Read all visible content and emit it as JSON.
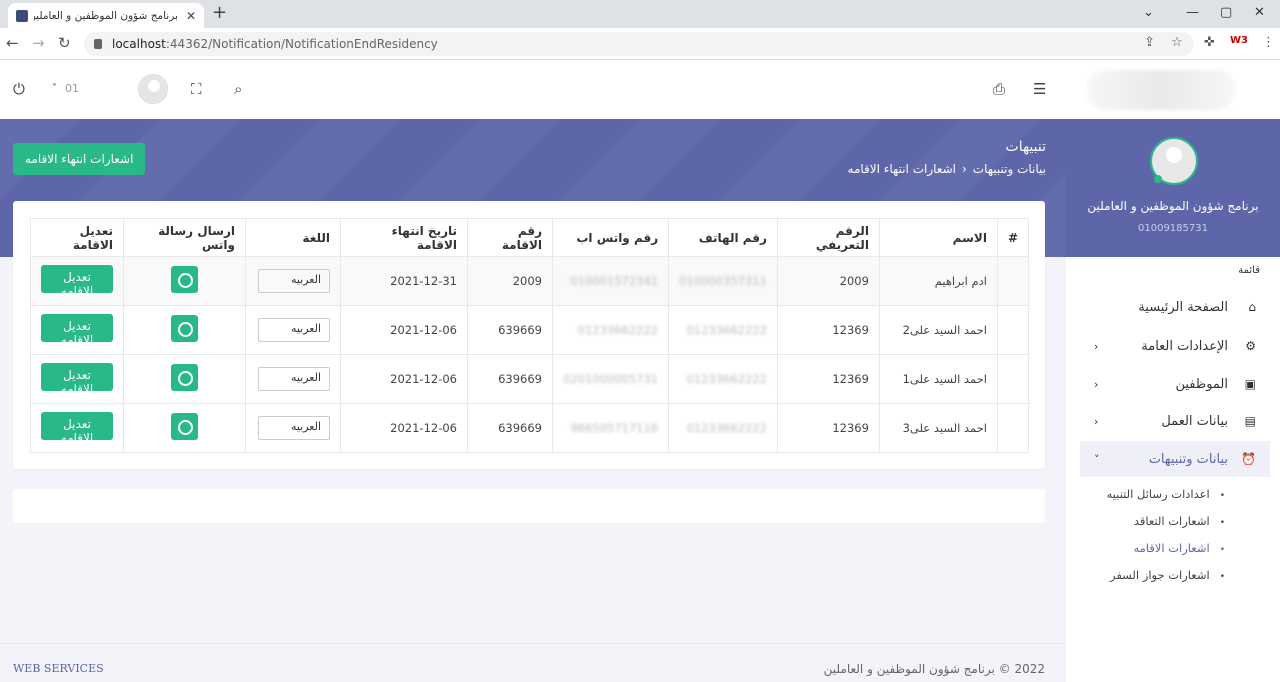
{
  "browser": {
    "tab_title": "برنامج شؤون الموظفين و العاملين",
    "url_host": "localhost",
    "url_path": ":44362/Notification/NotificationEndResidency"
  },
  "topbar": {
    "user_name_hidden": "01",
    "icons": [
      "power-icon",
      "chevron-down-icon",
      "avatar",
      "fullscreen-icon",
      "search-icon",
      "print-icon",
      "menu-icon"
    ]
  },
  "banner": {
    "title": "تنبيهات",
    "breadcrumb_parent": "بيانات وتنبيهات",
    "breadcrumb_current": "اشعارات انتهاء الاقامه",
    "action_button": "اشعارات انتهاء الاقامه"
  },
  "table": {
    "headers": [
      "#",
      "الاسم",
      "الرقم التعريفي",
      "رقم الهاتف",
      "رقم واتس اب",
      "رقم الاقامة",
      "تاريخ انتهاء الاقامة",
      "اللغة",
      "ارسال رسالة واتس",
      "تعديل الاقامة"
    ],
    "rows": [
      {
        "num": "",
        "name": "ادم ابراهيم",
        "id": "2009",
        "phone": "010000357311",
        "whatsapp": "010001572341",
        "residency": "2009",
        "expiry": "2021-12-31",
        "lang": "العربيه",
        "edit": "تعديل الاقامه"
      },
      {
        "num": "",
        "name": "احمد السيد على2",
        "id": "12369",
        "phone": "01233662222",
        "whatsapp": "01233662222",
        "residency": "639669",
        "expiry": "2021-12-06",
        "lang": "العربيه",
        "edit": "تعديل الاقامه"
      },
      {
        "num": "",
        "name": "احمد السيد على1",
        "id": "12369",
        "phone": "01233662222",
        "whatsapp": "0201000005731",
        "residency": "639669",
        "expiry": "2021-12-06",
        "lang": "العربيه",
        "edit": "تعديل الاقامه"
      },
      {
        "num": "",
        "name": "احمد السيد على3",
        "id": "12369",
        "phone": "01233662222",
        "whatsapp": "966505717116",
        "residency": "639669",
        "expiry": "2021-12-06",
        "lang": "العربيه",
        "edit": "تعديل الاقامه"
      }
    ]
  },
  "sidebar": {
    "app_name": "برنامج شؤون الموظفين و العاملين",
    "phone": "01009185731",
    "menu_label": "قائمة",
    "items": [
      {
        "label": "الصفحة الرئيسية",
        "icon": "home-icon",
        "arrow": ""
      },
      {
        "label": "الإعدادات العامة",
        "icon": "gear-icon",
        "arrow": "›"
      },
      {
        "label": "الموظفين",
        "icon": "contact-icon",
        "arrow": "›"
      },
      {
        "label": "بيانات العمل",
        "icon": "id-card-icon",
        "arrow": "›"
      },
      {
        "label": "بيانات وتنبيهات",
        "icon": "alarm-icon",
        "arrow": "˅"
      }
    ],
    "subitems": [
      "اعدادات رسائل التنبيه",
      "اشعارات التعاقد",
      "اشعارات الاقامه",
      "اشعارات جواز السفر"
    ]
  },
  "footer": {
    "left": "WEB SERVICES",
    "right": "2022 © برنامج شؤون الموظفين و العاملين"
  },
  "colors": {
    "primary": "#5d66a9",
    "accent": "#29b889"
  }
}
